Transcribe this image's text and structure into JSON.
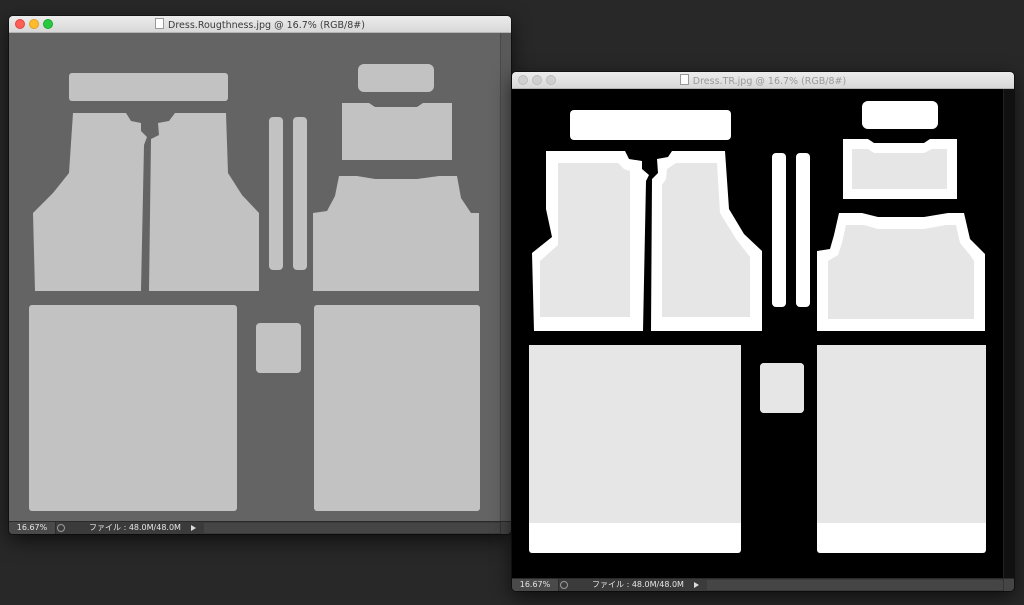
{
  "windows": {
    "roughness": {
      "title": "Dress.Rougthness.jpg @ 16.7% (RGB/8#)",
      "zoom": "16.67%",
      "file_info": "ファイル : 48.0M/48.0M",
      "traffic_lights": [
        "close-button",
        "minimize-button",
        "zoom-button"
      ],
      "colors": {
        "canvas": "#646464",
        "pieces": "#c2c2c2"
      }
    },
    "tr": {
      "title": "Dress.TR.jpg @ 16.7% (RGB/8#)",
      "zoom": "16.67%",
      "file_info": "ファイル : 48.0M/48.0M",
      "colors": {
        "canvas": "#000000",
        "pieces": "#e6e6e6",
        "border": "#ffffff"
      }
    }
  }
}
